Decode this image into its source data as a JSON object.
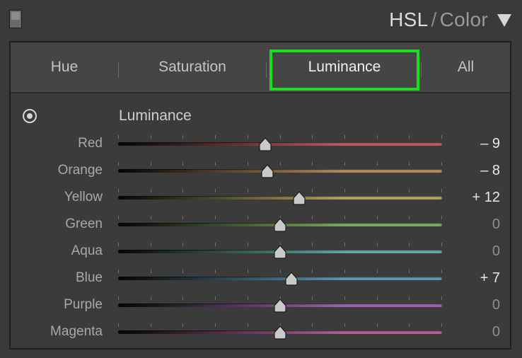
{
  "header": {
    "title_left": "HSL",
    "title_sep": "/",
    "title_right": "Color"
  },
  "tabs": [
    {
      "label": "Hue",
      "active": false
    },
    {
      "label": "Saturation",
      "active": false
    },
    {
      "label": "Luminance",
      "active": true
    },
    {
      "label": "All",
      "active": false
    }
  ],
  "section": {
    "label": "Luminance"
  },
  "sliders": [
    {
      "label": "Red",
      "value_text": "– 9",
      "value": -9,
      "color": "#c05a5a"
    },
    {
      "label": "Orange",
      "value_text": "– 8",
      "value": -8,
      "color": "#b38a5e"
    },
    {
      "label": "Yellow",
      "value_text": "+ 12",
      "value": 12,
      "color": "#b0a75a"
    },
    {
      "label": "Green",
      "value_text": "0",
      "value": 0,
      "color": "#7aaa5c"
    },
    {
      "label": "Aqua",
      "value_text": "0",
      "value": 0,
      "color": "#5fa8a0"
    },
    {
      "label": "Blue",
      "value_text": "+ 7",
      "value": 7,
      "color": "#5e93b3"
    },
    {
      "label": "Purple",
      "value_text": "0",
      "value": 0,
      "color": "#a062b0"
    },
    {
      "label": "Magenta",
      "value_text": "0",
      "value": 0,
      "color": "#b55c9a"
    }
  ],
  "slider_range": [
    -100,
    100
  ],
  "colors": {
    "highlight": "#19e019",
    "background": "#3a3a3a"
  }
}
